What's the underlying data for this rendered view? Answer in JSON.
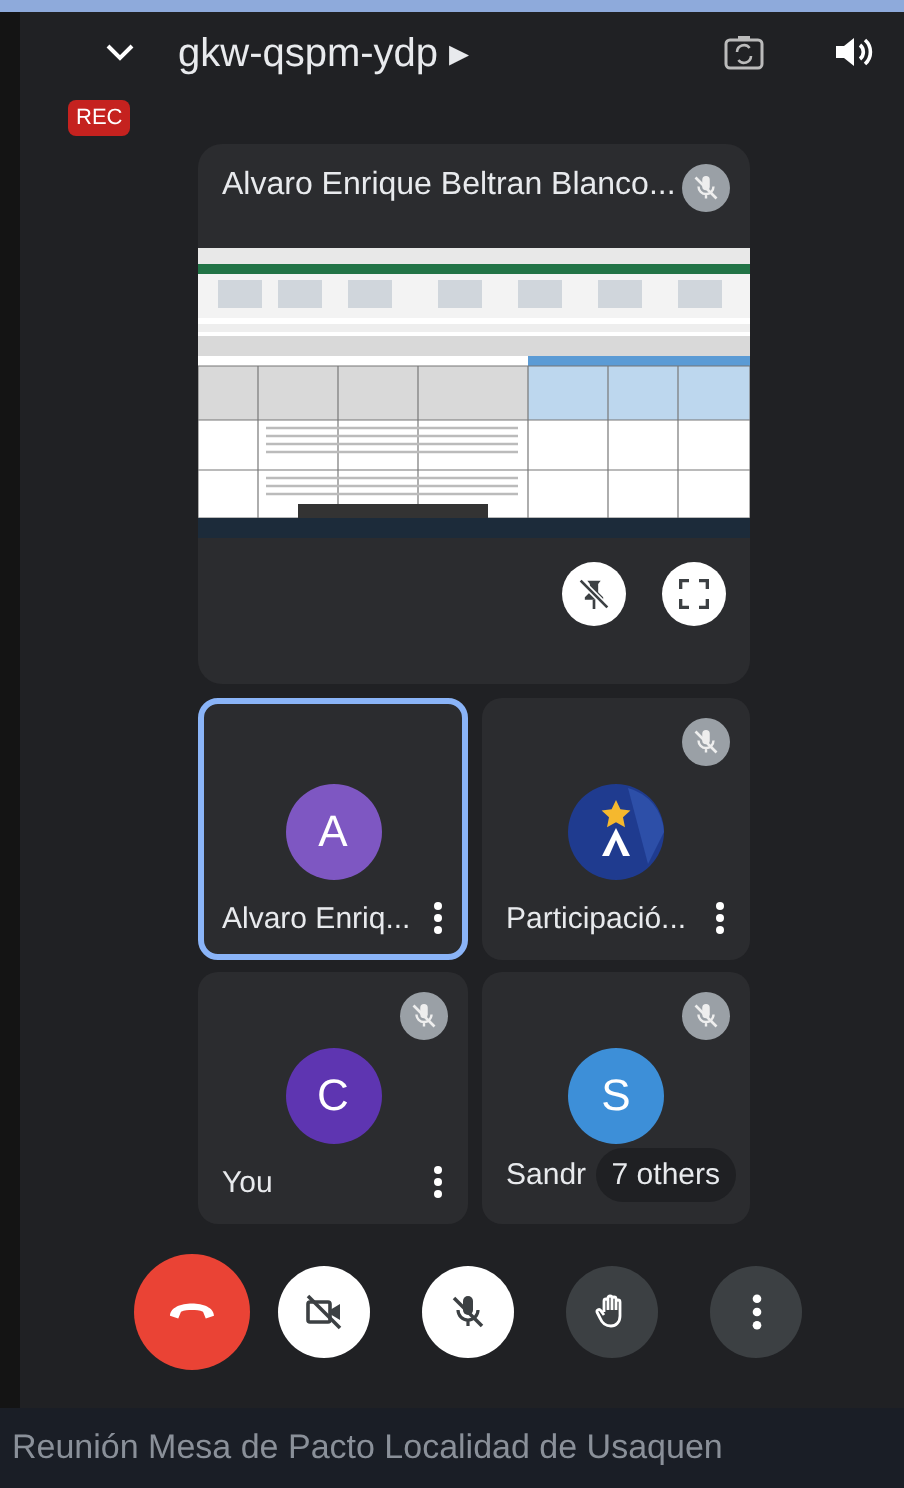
{
  "header": {
    "meeting_code": "gkw-qspm-ydp ▸"
  },
  "recording_badge": "REC",
  "presenter_tile": {
    "name": "Alvaro Enrique Beltran Blanco...",
    "muted": true
  },
  "participants": [
    {
      "name": "Alvaro Enriq...",
      "kind": "letter",
      "letter": "A",
      "color": "#7e57c2",
      "muted": false,
      "speaking": true
    },
    {
      "name": "Participació...",
      "kind": "logo",
      "muted": true,
      "speaking": false
    },
    {
      "name": "You",
      "kind": "letter",
      "letter": "C",
      "color": "#5e35b1",
      "muted": true,
      "speaking": false
    },
    {
      "name": "Sandr",
      "kind": "letter",
      "letter": "S",
      "color": "#3d8fd8",
      "muted": true,
      "speaking": false,
      "others": "7 others"
    }
  ],
  "controls": [
    {
      "kind": "hangup"
    },
    {
      "kind": "camera",
      "on": false
    },
    {
      "kind": "mic",
      "on": false
    },
    {
      "kind": "hand"
    },
    {
      "kind": "more"
    }
  ],
  "caption": "Reunión Mesa de Pacto Localidad de Usaquen"
}
